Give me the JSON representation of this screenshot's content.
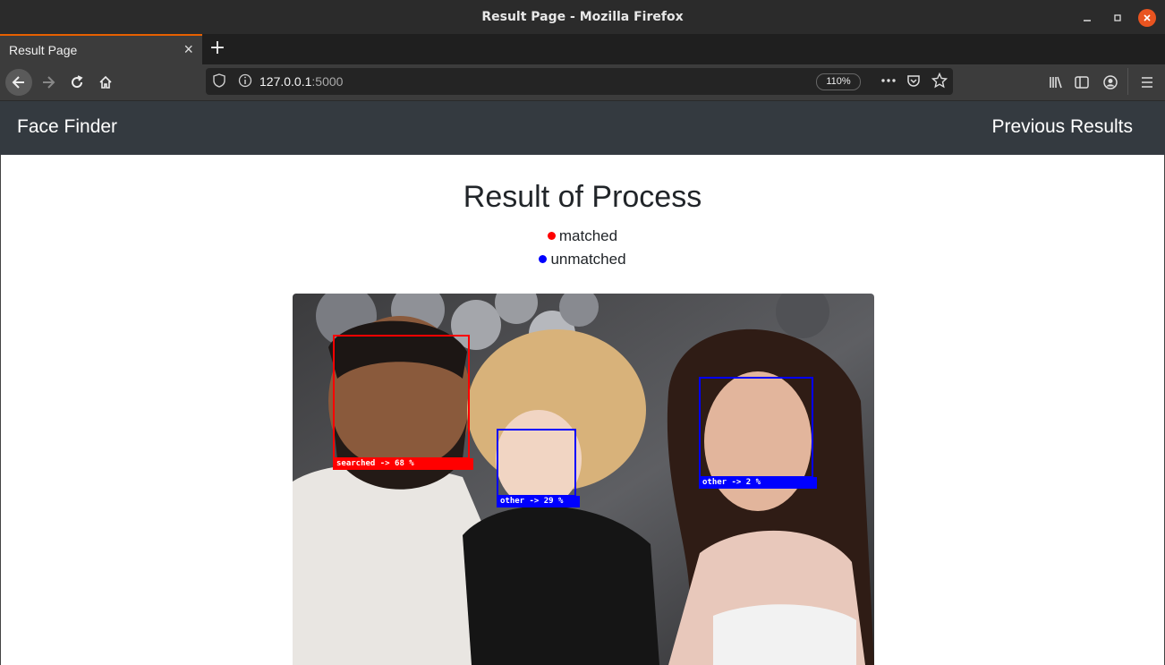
{
  "window": {
    "title": "Result Page - Mozilla Firefox"
  },
  "browser": {
    "tab_title": "Result Page",
    "url_host": "127.0.0.1",
    "url_port": ":5000",
    "zoom": "110%"
  },
  "app_nav": {
    "brand": "Face Finder",
    "previous_results": "Previous Results"
  },
  "page": {
    "title": "Result of Process",
    "legend": [
      {
        "label": "matched",
        "color": "#ff0000"
      },
      {
        "label": "unmatched",
        "color": "#0000ff"
      }
    ]
  },
  "faces": [
    {
      "label": "searched -> 68 %",
      "color": "#ff0000"
    },
    {
      "label": "other -> 29 %",
      "color": "#0000ff"
    },
    {
      "label": "other -> 2 %",
      "color": "#0000ff"
    }
  ]
}
